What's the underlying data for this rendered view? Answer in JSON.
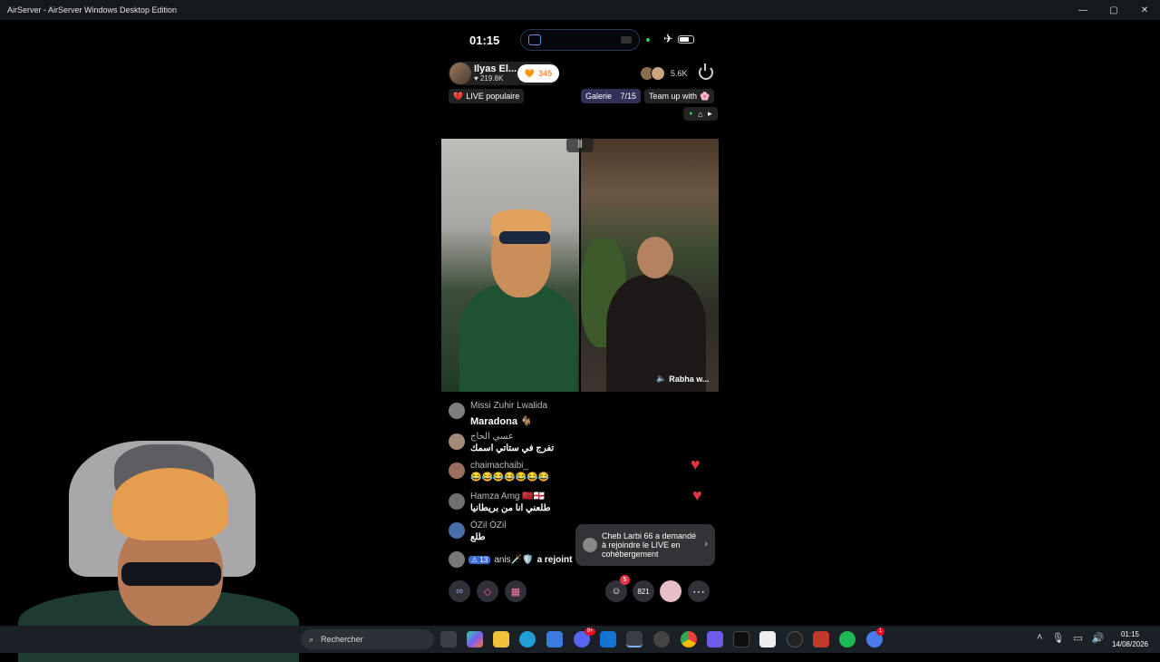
{
  "window": {
    "title": "AirServer - AirServer Windows Desktop Edition"
  },
  "phone": {
    "time": "01:15",
    "host": {
      "name": "Ilyas El...",
      "likes": "219.8K",
      "heart_count": "345"
    },
    "viewer_count": "5.6K",
    "chips": {
      "live_popular": "LIVE populaire",
      "gallery": "Galerie",
      "gallery_count": "7/15",
      "team_up": "Team up with"
    },
    "guest_label": "Rabha w...",
    "comments": [
      {
        "user": "Missi Zuhir Lwalida",
        "text": "Maradona 🐐"
      },
      {
        "user": "عسي الحاج",
        "text": "تفرج في ستاتي اسمك"
      },
      {
        "user": "chaimachaibi_",
        "text": "😂😂😂😂😂😂😂"
      },
      {
        "user": "Hamza Amg 🇲🇦🏴󠁧󠁢󠁥󠁮󠁧󠁿",
        "text": "طلعني انا من بريطانيا"
      },
      {
        "user": "ÖZil ÖZil",
        "text": "طلع"
      }
    ],
    "joined": {
      "level": "13",
      "user": "anis🗡️🛡️",
      "text": "a rejoint"
    },
    "notification": "Cheb Larbi 66 a demandé à rejoindre le LIVE en cohébergement",
    "bottom": {
      "requests_badge": "5",
      "share_count": "821"
    }
  },
  "taskbar": {
    "search_placeholder": "Rechercher",
    "time": "01:15",
    "date": "14/08/2026",
    "copilot_badge": "9+",
    "store_badge": "1"
  },
  "colors": {
    "heart": "#e03345",
    "accent_blue": "#3b6ad1",
    "taskbar": "#1b2026"
  }
}
